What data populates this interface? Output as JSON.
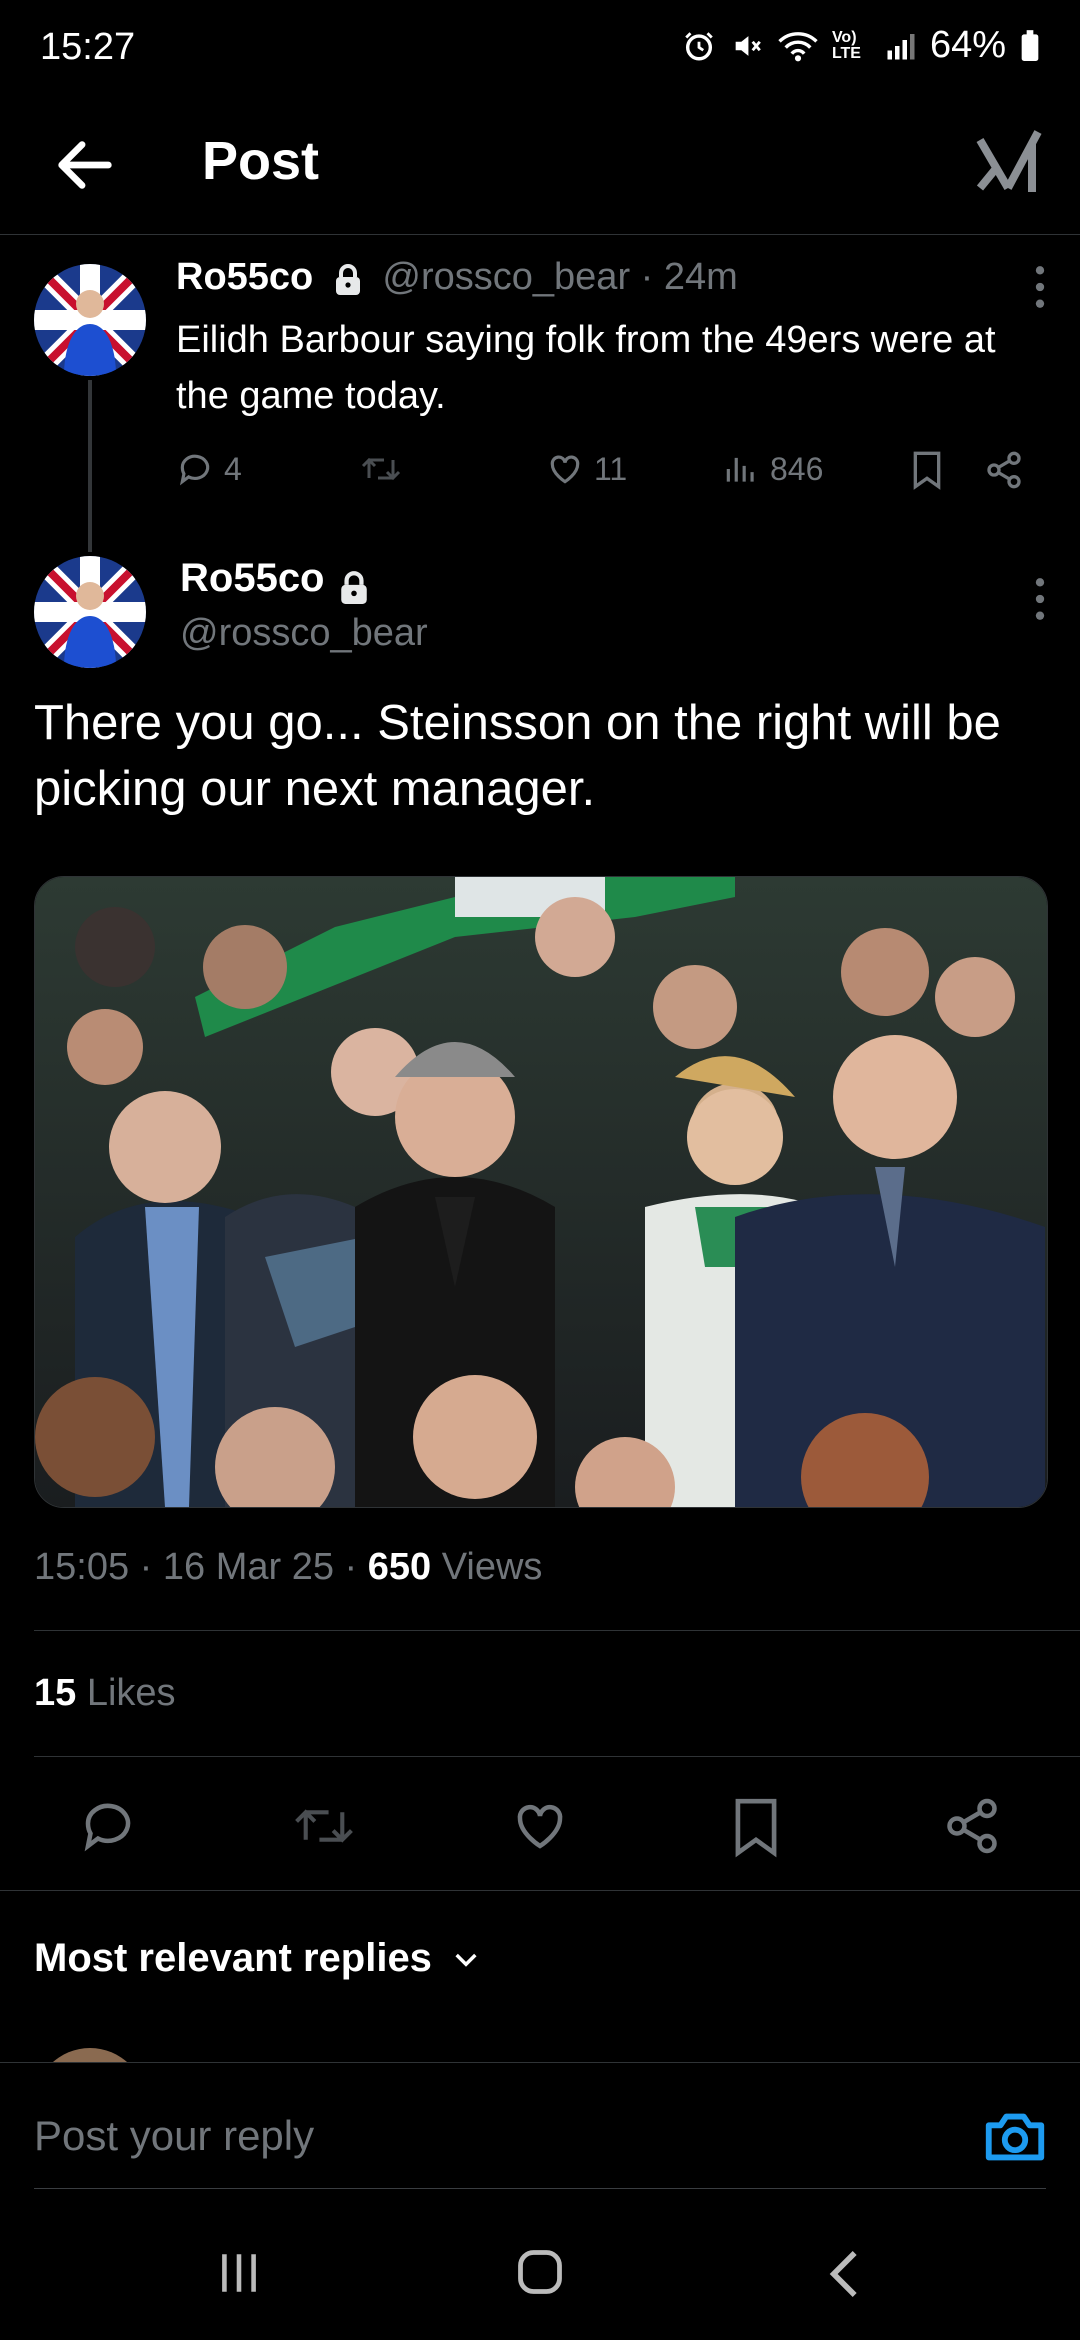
{
  "status_bar": {
    "time": "15:27",
    "battery": "64%",
    "network": "Vo) LTE"
  },
  "header": {
    "title": "Post"
  },
  "parent_tweet": {
    "name": "Ro55co",
    "handle": "@rossco_bear",
    "separator": "·",
    "time_ago": "24m",
    "text": "Eilidh Barbour saying folk from the 49ers were at the game today.",
    "replies": "4",
    "likes": "11",
    "views": "846"
  },
  "main_tweet": {
    "name": "Ro55co",
    "handle": "@rossco_bear",
    "text": "There you go... Steinsson on the right will be picking our next manager.",
    "time": "15:05",
    "dot": "·",
    "date": "16 Mar 25",
    "views_count": "650",
    "views_label": "Views",
    "likes_count": "15",
    "likes_label": "Likes"
  },
  "replies_section": {
    "title": "Most relevant replies"
  },
  "reply_bar": {
    "placeholder": "Post your reply"
  },
  "colors": {
    "accent": "#1d9bf0",
    "background": "#000000",
    "divider": "#2f3336",
    "muted": "#71767b"
  },
  "icons": [
    "back-arrow-icon",
    "grok-icon",
    "lock-icon",
    "more-icon",
    "reply-icon",
    "retweet-icon",
    "heart-icon",
    "views-icon",
    "bookmark-icon",
    "share-icon",
    "chevron-down-icon",
    "camera-icon"
  ]
}
